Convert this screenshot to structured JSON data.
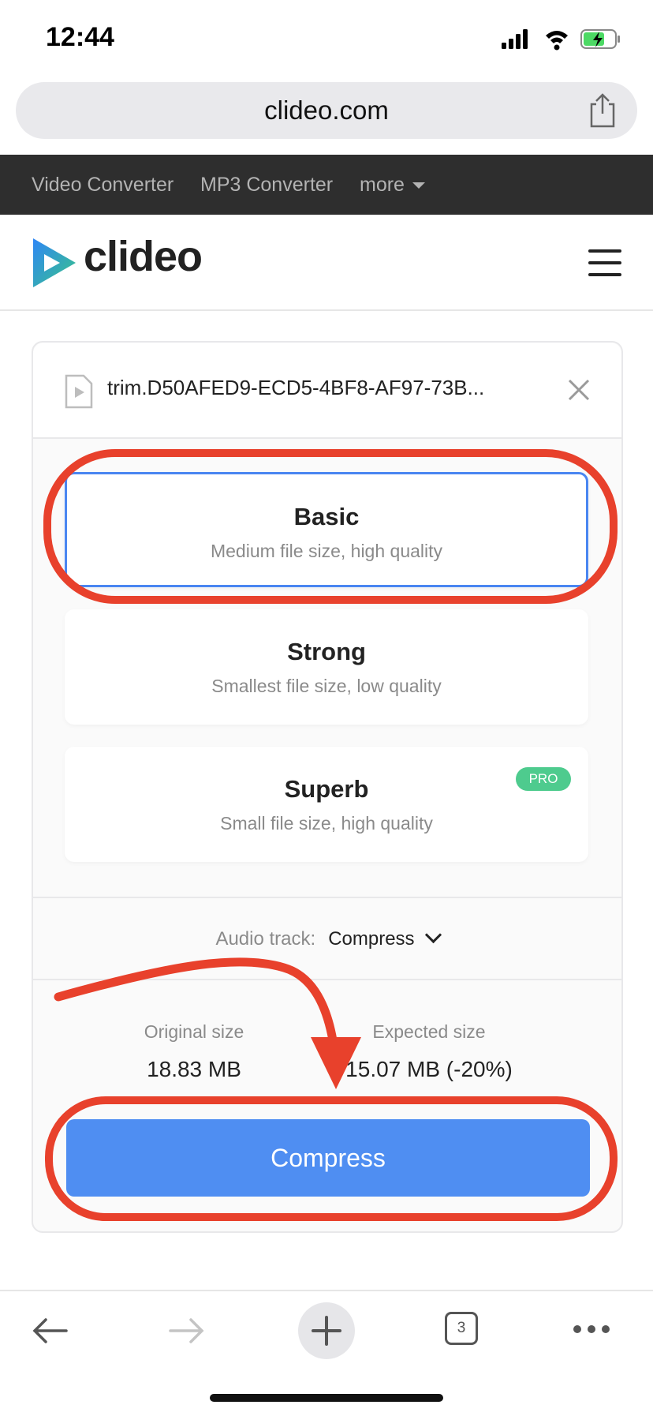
{
  "status": {
    "time": "12:44"
  },
  "browser": {
    "url": "clideo.com",
    "tab_count": "3"
  },
  "topnav": {
    "items": [
      "Video Converter",
      "MP3 Converter",
      "more"
    ]
  },
  "brand": {
    "name": "clideo"
  },
  "file": {
    "name": "trim.D50AFED9-ECD5-4BF8-AF97-73B..."
  },
  "options": [
    {
      "title": "Basic",
      "subtitle": "Medium file size, high quality"
    },
    {
      "title": "Strong",
      "subtitle": "Smallest file size, low quality"
    },
    {
      "title": "Superb",
      "subtitle": "Small file size, high quality",
      "badge": "PRO"
    }
  ],
  "audio": {
    "label": "Audio track:",
    "value": "Compress"
  },
  "sizes": {
    "original_label": "Original size",
    "original_value": "18.83 MB",
    "expected_label": "Expected size",
    "expected_value": "15.07 MB (-20%)"
  },
  "actions": {
    "compress_label": "Compress"
  },
  "colors": {
    "accent": "#4f8ef2",
    "selected_border": "#4a86f1",
    "annotation": "#e8412c",
    "pro_badge": "#4ecb8e"
  }
}
